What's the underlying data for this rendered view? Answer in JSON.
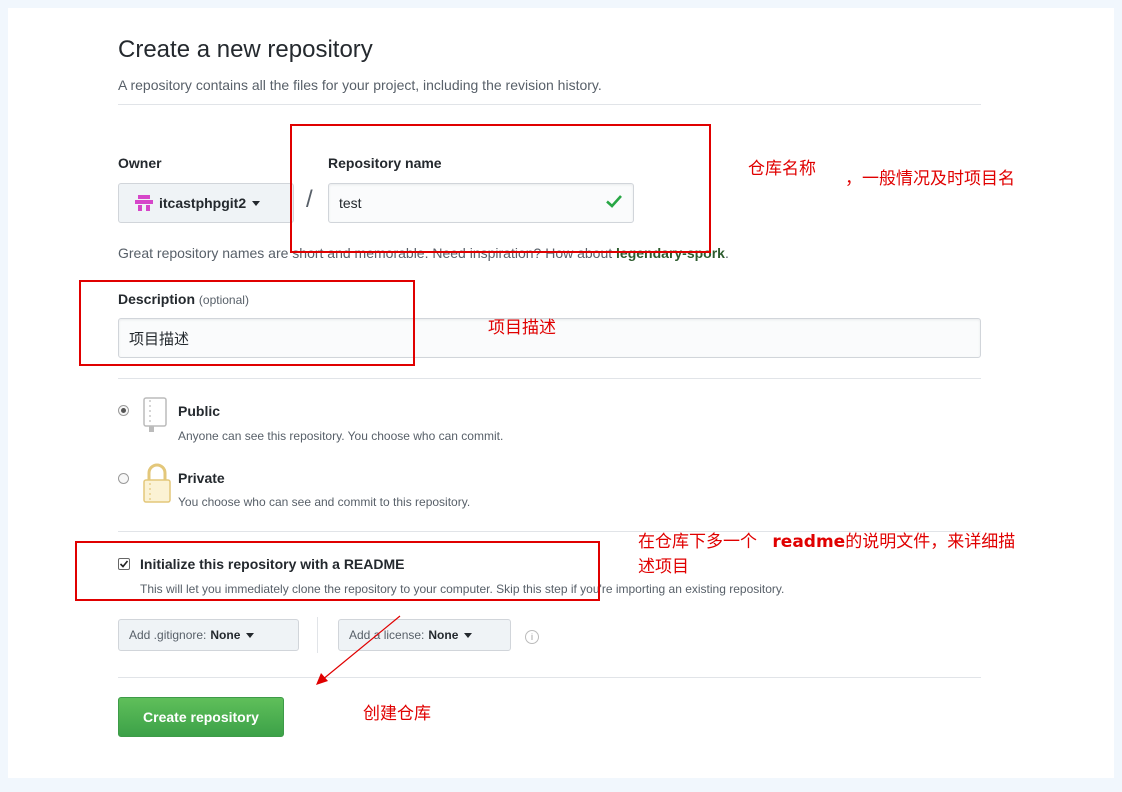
{
  "page": {
    "title": "Create a new repository",
    "subtitle": "A repository contains all the files for your project, including the revision history."
  },
  "owner": {
    "label": "Owner",
    "value": "itcastphpgit2"
  },
  "slash": "/",
  "repo": {
    "label": "Repository name",
    "value": "test"
  },
  "suggestion": {
    "text": "Great repository names are short and memorable. Need inspiration? How about ",
    "name": "legendary-spork",
    "end": "."
  },
  "description": {
    "label": "Description",
    "optional": "(optional)",
    "value": "项目描述"
  },
  "visibility": {
    "public": {
      "title": "Public",
      "desc": "Anyone can see this repository. You choose who can commit.",
      "selected": true
    },
    "private": {
      "title": "Private",
      "desc": "You choose who can see and commit to this repository.",
      "selected": false
    }
  },
  "readme": {
    "label": "Initialize this repository with a README",
    "desc": "This will let you immediately clone the repository to your computer. Skip this step if you're importing an existing repository.",
    "checked": true
  },
  "gitignore": {
    "label": "Add .gitignore:",
    "value": "None"
  },
  "license": {
    "label": "Add a license:",
    "value": "None"
  },
  "create_button": "Create repository",
  "annotations": {
    "repo_name": "仓库名称",
    "repo_name_note": "，一般情况及时项目名",
    "description": "项目描述",
    "readme_line1": "在仓库下多一个",
    "readme_bold": "readme",
    "readme_line1_end": "的说明文件，来详细描",
    "readme_line2": "述项目",
    "create": "创建仓库"
  },
  "colors": {
    "accent_green": "#3ca148",
    "annotation_red": "#e00000",
    "link_green": "#2c5b2d"
  }
}
